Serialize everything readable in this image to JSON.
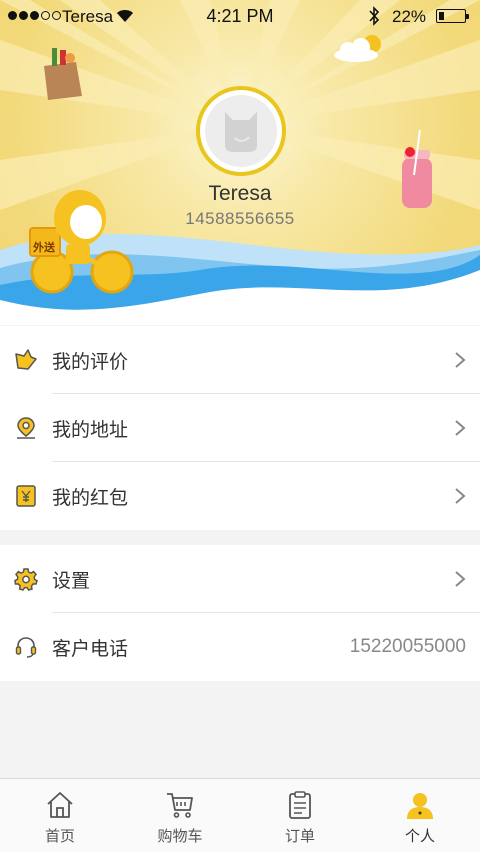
{
  "status_bar": {
    "carrier": "Teresa",
    "time": "4:21 PM",
    "battery": "22%"
  },
  "profile": {
    "username": "Teresa",
    "phone": "14588556655",
    "scooter_sign": "外送"
  },
  "menu_group1": [
    {
      "label": "我的评价",
      "icon": "star-icon"
    },
    {
      "label": "我的地址",
      "icon": "location-pin-icon"
    },
    {
      "label": "我的红包",
      "icon": "red-packet-icon"
    }
  ],
  "menu_group2": [
    {
      "label": "设置",
      "icon": "gear-icon"
    },
    {
      "label": "客户电话",
      "icon": "headset-icon",
      "value": "15220055000"
    }
  ],
  "tabs": [
    {
      "label": "首页",
      "icon": "home-icon"
    },
    {
      "label": "购物车",
      "icon": "cart-icon"
    },
    {
      "label": "订单",
      "icon": "clipboard-icon"
    },
    {
      "label": "个人",
      "icon": "person-icon",
      "active": true
    }
  ],
  "colors": {
    "accent": "#e8b410",
    "icon_gray": "#555555",
    "wave_blue": "#3aa5e8"
  }
}
